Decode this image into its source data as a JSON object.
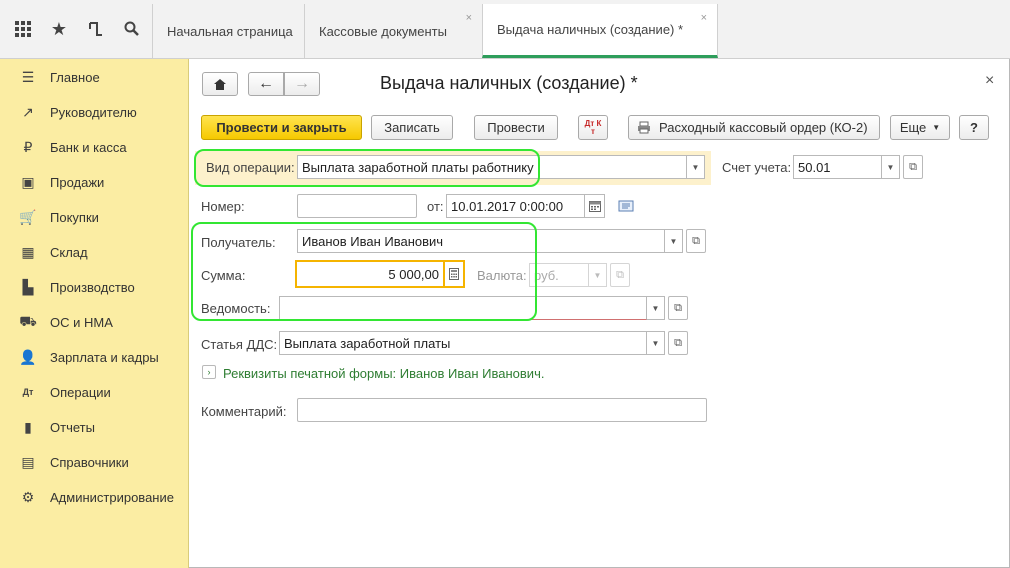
{
  "topbar": {
    "tabs": [
      {
        "label": "Начальная страница"
      },
      {
        "label": "Кассовые документы",
        "close": "×"
      },
      {
        "label": "Выдача наличных (создание) *",
        "close": "×"
      }
    ]
  },
  "sidebar": {
    "items": [
      {
        "label": "Главное",
        "icon": "☰"
      },
      {
        "label": "Руководителю",
        "icon": "↗"
      },
      {
        "label": "Банк и касса",
        "icon": "₽"
      },
      {
        "label": "Продажи",
        "icon": "▣"
      },
      {
        "label": "Покупки",
        "icon": "🛒"
      },
      {
        "label": "Склад",
        "icon": "▦"
      },
      {
        "label": "Производство",
        "icon": "▙"
      },
      {
        "label": "ОС и НМА",
        "icon": "⛟"
      },
      {
        "label": "Зарплата и кадры",
        "icon": "👤"
      },
      {
        "label": "Операции",
        "icon": "Дт"
      },
      {
        "label": "Отчеты",
        "icon": "▮"
      },
      {
        "label": "Справочники",
        "icon": "▤"
      },
      {
        "label": "Администрирование",
        "icon": "⚙"
      }
    ]
  },
  "form": {
    "title": "Выдача наличных (создание) *",
    "close": "×",
    "toolbar": {
      "post_close": "Провести и закрыть",
      "write": "Записать",
      "post": "Провести",
      "dt_kt": "Дт Кт",
      "print_order": "Расходный кассовый ордер (КО-2)",
      "more": "Еще",
      "help": "?"
    },
    "operation_label": "Вид операции:",
    "operation_value": "Выплата заработной платы работнику",
    "account_label": "Счет учета:",
    "account_value": "50.01",
    "number_label": "Номер:",
    "number_value": "",
    "date_label": "от:",
    "date_value": "10.01.2017  0:00:00",
    "recipient_label": "Получатель:",
    "recipient_value": "Иванов Иван Иванович",
    "amount_label": "Сумма:",
    "amount_value": "5 000,00",
    "currency_label": "Валюта:",
    "currency_value": "руб.",
    "statement_label": "Ведомость:",
    "statement_value": "",
    "dds_label": "Статья ДДС:",
    "dds_value": "Выплата заработной платы",
    "print_details": "Реквизиты печатной формы: Иванов Иван Иванович.",
    "comment_label": "Комментарий:",
    "comment_value": ""
  },
  "colors": {
    "sidebar_bg": "#fbeda3",
    "primary_button": "#f6c900",
    "highlight_green": "#33e633",
    "tab_active_underline": "#2e9e5b",
    "link_green": "#2e7d32"
  }
}
